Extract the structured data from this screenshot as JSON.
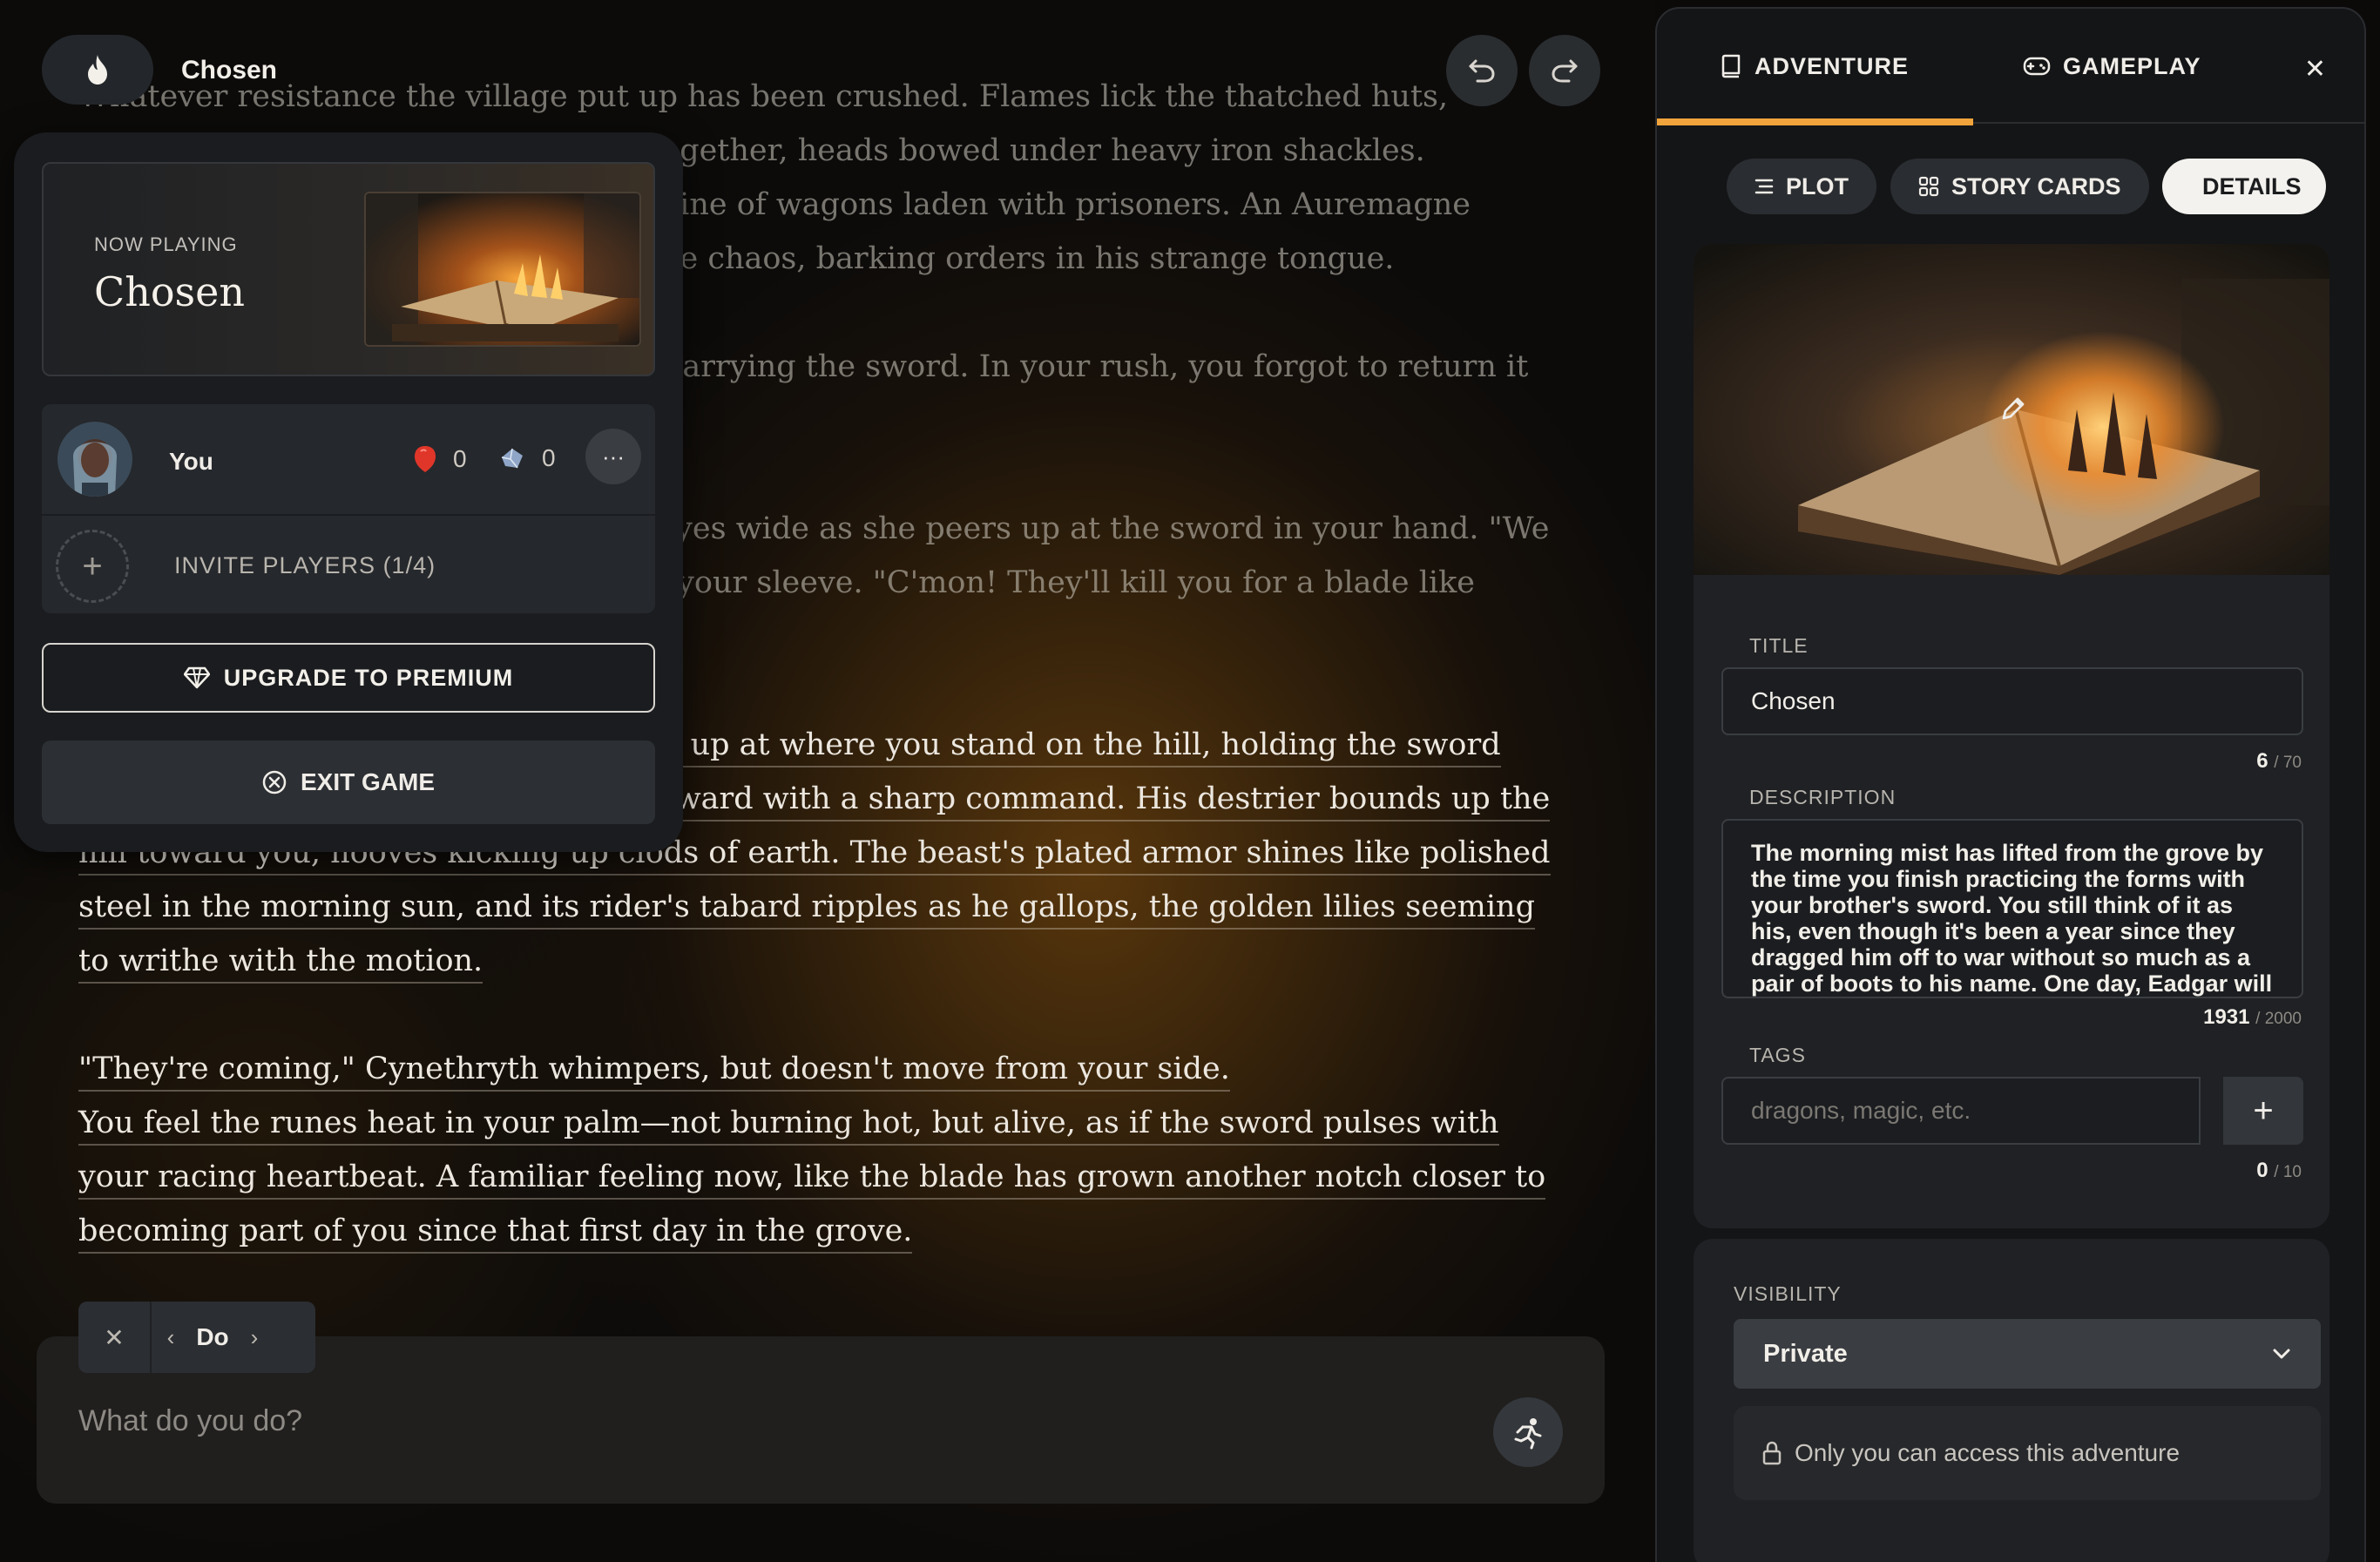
{
  "game": {
    "title": "Chosen",
    "flame_icon": "flame-icon",
    "undo_icon": "undo-icon",
    "redo_icon": "redo-icon"
  },
  "story": {
    "paragraphs": [
      "Whatever resistance the village put up has been crushed. Flames lick the thatched huts, screams rise as villagers are herded together, heads bowed under heavy iron shackles. Soldiers prod the stragglers toward a line of wagons laden with prisoners. An Auremagne knight on an armored horse surveys the chaos, barking orders in his strange tongue.",
      "You look down and realize you're still carrying the sword. In your rush, you forgot to return it to its hiding place.",
      "Cynethryth ducks down at your side, eyes wide as she peers up at the sword in your hand. \"We have to go,\" she whimpers, tugging at your sleeve. \"C'mon! They'll kill you for a blade like that.\"",
      "The knight on the armored horse looks up at where you stand on the hill, holding the sword aloft in the sun. He spurs his horse forward with a sharp command. His destrier bounds up the hill toward you, hooves kicking up clods of earth. The beast's plated armor shines like polished steel in the morning sun, and its rider's tabard ripples as he gallops, the golden lilies seeming to writhe with the motion.",
      "\"They're coming,\" Cynethryth whimpers, but doesn't move from your side.",
      "You feel the runes heat in your palm—not burning hot, but alive, as if the sword pulses with your racing heartbeat. A familiar feeling now, like the blade has grown another notch closer to becoming part of you since that first day in the grove."
    ]
  },
  "menu": {
    "now_playing_label": "NOW PLAYING",
    "now_playing_title": "Chosen",
    "player": {
      "name": "You",
      "hearts": "0",
      "gems": "0",
      "more_label": "···"
    },
    "invite_label": "INVITE PLAYERS (1/4)",
    "premium_label": "UPGRADE TO PREMIUM",
    "exit_label": "EXIT GAME"
  },
  "action": {
    "mode": "Do",
    "placeholder": "What do you do?",
    "prev": "‹",
    "next": "›",
    "close": "✕"
  },
  "panel": {
    "tabs": [
      {
        "label": "ADVENTURE",
        "icon": "book-icon",
        "active": true
      },
      {
        "label": "GAMEPLAY",
        "icon": "gamepad-icon",
        "active": false
      }
    ],
    "pills": [
      {
        "label": "PLOT",
        "icon": "plot-icon"
      },
      {
        "label": "STORY CARDS",
        "icon": "cards-icon"
      },
      {
        "label": "DETAILS",
        "icon": "list-icon"
      }
    ],
    "title_label": "TITLE",
    "title_value": "Chosen",
    "title_count": "6",
    "title_max": "/ 70",
    "description_label": "DESCRIPTION",
    "description_value": "The morning mist has lifted from the grove by the time you finish practicing the forms with your brother's sword. You still think of it as his, even though it's been a year since they dragged him off to war without so much as a pair of boots to his name. One day, Eadgar will",
    "description_count": "1931",
    "description_max": "/ 2000",
    "tags_label": "TAGS",
    "tags_placeholder": "dragons, magic, etc.",
    "tags_count": "0",
    "tags_max": "/ 10",
    "visibility_label": "VISIBILITY",
    "visibility_value": "Private",
    "visibility_note": "Only you can access this adventure"
  },
  "colors": {
    "accent": "#f0a43b",
    "heart": "#e0362a",
    "gem": "#8fa6c8"
  }
}
